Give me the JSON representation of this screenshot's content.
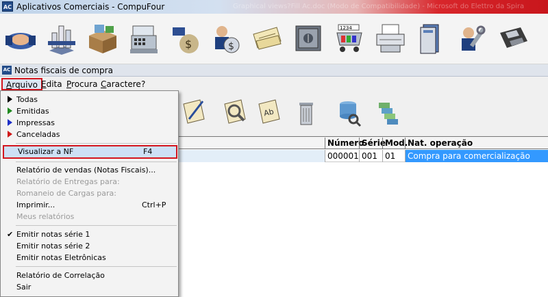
{
  "window": {
    "title": "Aplicativos Comerciais - CompuFour",
    "icon_text": "AC",
    "background_text": "Graphical views?Fill Ac.doc (Modo de Compatibilidade) - Microsoft do Elettro da Spira"
  },
  "main_toolbar": {
    "icons": [
      "handshake-icon",
      "building-chart-icon",
      "boxes-icon",
      "cash-register-icon",
      "money-bag-hand-icon",
      "money-coin-person-icon",
      "checkbook-icon",
      "safe-icon",
      "shopping-cart-numbers-icon",
      "printer-icon",
      "books-icon",
      "tools-icon",
      "floppy-disk-icon"
    ]
  },
  "child_window": {
    "title": "Notas fiscais de compra",
    "icon_text": "AC"
  },
  "menubar": {
    "items": [
      {
        "label": "Arquivo",
        "underline": "A"
      },
      {
        "label": "Edita",
        "underline": "E"
      },
      {
        "label": "Procura",
        "underline": "P"
      },
      {
        "label": "Caractere",
        "underline": "C"
      },
      {
        "label": "?"
      }
    ]
  },
  "second_toolbar": {
    "icons": [
      "edit-document-icon",
      "search-document-icon",
      "text-document-icon",
      "trash-bin-icon",
      "database-search-icon",
      "stacked-papers-icon"
    ]
  },
  "grid": {
    "columns": [
      "Número",
      "Série",
      "Mod.",
      "Nat. operação"
    ],
    "rows": [
      {
        "numero": "000001",
        "serie": "001",
        "mod": "01",
        "nat_operacao": "Compra para comercialização"
      }
    ]
  },
  "colors": {
    "highlight_border": "#d3151e",
    "selection": "#3399ff",
    "triangle_black": "#000000",
    "triangle_green": "#1f8a1f",
    "triangle_blue": "#1e2fc8",
    "triangle_red": "#d01818"
  },
  "file_menu": {
    "filters": [
      {
        "label": "Todas",
        "marker_color": "#000000"
      },
      {
        "label": "Emitidas",
        "marker_color": "#1f8a1f"
      },
      {
        "label": "Impressas",
        "marker_color": "#1e2fc8"
      },
      {
        "label": "Canceladas",
        "marker_color": "#d01818"
      }
    ],
    "view_nf": {
      "label": "Visualizar a NF",
      "shortcut": "F4"
    },
    "reports": [
      {
        "label": "Relatório de vendas (Notas Fiscais)...",
        "enabled": true
      },
      {
        "label": "Relatório de Entregas para:",
        "enabled": false
      },
      {
        "label": "Romaneio de Cargas para:",
        "enabled": false
      },
      {
        "label": "Imprimir...",
        "shortcut": "Ctrl+P",
        "enabled": true
      },
      {
        "label": "Meus relatórios",
        "enabled": false
      }
    ],
    "emit": [
      {
        "label": "Emitir notas série 1",
        "checked": true
      },
      {
        "label": "Emitir notas série 2",
        "checked": false
      },
      {
        "label": "Emitir notas Eletrônicas",
        "checked": false
      }
    ],
    "correlation": {
      "label": "Relatório de Correlação"
    },
    "exit": {
      "label": "Sair"
    }
  }
}
